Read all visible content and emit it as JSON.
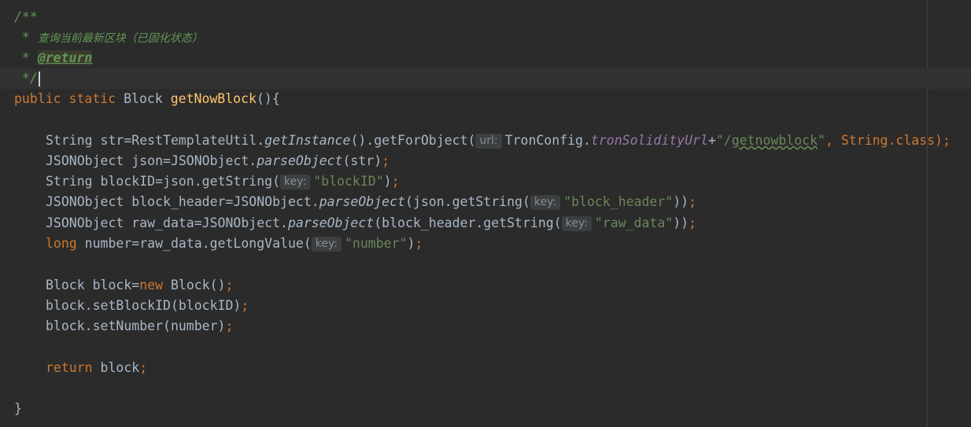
{
  "code": {
    "doc_open": "/**",
    "doc_desc_prefix": " * ",
    "doc_desc": "查询当前最新区块（已固化状态）",
    "doc_tag_prefix": " * ",
    "doc_tag": "@return",
    "doc_close": " */",
    "method_sig": {
      "kw1": "public",
      "kw2": "static",
      "return_type": "Block",
      "name": "getNowBlock",
      "tail": "(){"
    },
    "line_str": {
      "a": "String str=RestTemplateUtil.",
      "m1": "getInstance",
      "b": "().getForObject(",
      "hint": "url:",
      "c": "TronConfig.",
      "field": "tronSolidityUrl",
      "d": "+",
      "s1": "\"/",
      "s2": "getnowblock",
      "s3": "\"",
      "e": ", String.",
      "kw": "class",
      "f": ");"
    },
    "line_json": {
      "a": "JSONObject json=JSONObject.",
      "m": "parseObject",
      "b": "(str)",
      "c": ";"
    },
    "line_blockid": {
      "a": "String blockID=json.getString(",
      "hint": "key:",
      "s": "\"blockID\"",
      "b": ")",
      "c": ";"
    },
    "line_header": {
      "a": "JSONObject block_header=JSONObject.",
      "m": "parseObject",
      "b": "(json.getString(",
      "hint": "key:",
      "s": "\"block_header\"",
      "c": "))",
      "d": ";"
    },
    "line_raw": {
      "a": "JSONObject raw_data=JSONObject.",
      "m": "parseObject",
      "b": "(block_header.getString(",
      "hint": "key:",
      "s": "\"raw_data\"",
      "c": "))",
      "d": ";"
    },
    "line_number": {
      "kw": "long",
      "a": " number=raw_data.getLongValue(",
      "hint": "key:",
      "s": "\"number\"",
      "b": ")",
      "c": ";"
    },
    "line_block": {
      "a": "Block block=",
      "kw": "new",
      "b": " Block()",
      "c": ";"
    },
    "line_setid": {
      "a": "block.setBlockID(blockID)",
      "c": ";"
    },
    "line_setnum": {
      "a": "block.setNumber(number)",
      "c": ";"
    },
    "line_return": {
      "kw": "return",
      "a": " block",
      "c": ";"
    },
    "close_brace": "}"
  }
}
